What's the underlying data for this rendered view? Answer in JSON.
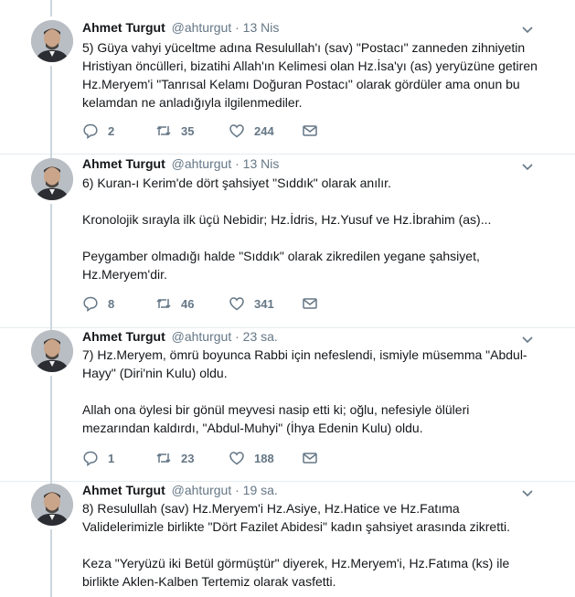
{
  "author": {
    "name": "Ahmet Turgut",
    "handle": "@ahturgut",
    "separator": "·"
  },
  "tweets": [
    {
      "time": "13 Nis",
      "paragraphs": [
        "5) Güya vahyi yüceltme adına Resulullah'ı (sav) \"Postacı\" zanneden zihniyetin Hristiyan öncülleri, bizatihi Allah'ın Kelimesi olan Hz.İsa'yı (as) yeryüzüne getiren Hz.Meryem'i \"Tanrısal Kelamı Doğuran Postacı\" olarak gördüler ama onun bu kelamdan ne anladığıyla ilgilenmediler."
      ],
      "replies": "2",
      "retweets": "35",
      "likes": "244"
    },
    {
      "time": "13 Nis",
      "paragraphs": [
        "6) Kuran-ı Kerim'de dört şahsiyet \"Sıddık\" olarak anılır.",
        "Kronolojik sırayla ilk üçü Nebidir; Hz.İdris, Hz.Yusuf ve Hz.İbrahim (as)...",
        "Peygamber olmadığı halde \"Sıddık\" olarak zikredilen yegane şahsiyet, Hz.Meryem'dir."
      ],
      "replies": "8",
      "retweets": "46",
      "likes": "341"
    },
    {
      "time": "23 sa.",
      "paragraphs": [
        "7) Hz.Meryem, ömrü boyunca Rabbi için nefeslendi, ismiyle müsemma \"Abdul-Hayy\" (Diri'nin Kulu) oldu.",
        "Allah ona öylesi bir gönül meyvesi nasip etti ki; oğlu, nefesiyle ölüleri mezarından kaldırdı, \"Abdul-Muhyi\" (İhya Edenin Kulu) oldu."
      ],
      "replies": "1",
      "retweets": "23",
      "likes": "188"
    },
    {
      "time": "19 sa.",
      "paragraphs": [
        "8) Resulullah (sav) Hz.Meryem'i Hz.Asiye, Hz.Hatice ve Hz.Fatıma Validelerimizle birlikte \"Dört Fazilet Abidesi\" kadın şahsiyet arasında zikretti.",
        "Keza \"Yeryüzü iki Betül görmüştür\" diyerek, Hz.Meryem'i, Hz.Fatıma (ks) ile birlikte Aklen-Kalben Tertemiz olarak vasfetti."
      ]
    }
  ]
}
